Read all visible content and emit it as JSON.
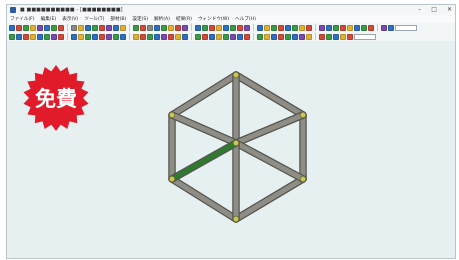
{
  "window": {
    "title": "■ ■■■■■■■■■■ - [■■■■■■■■]"
  },
  "menu": {
    "items": [
      "ファイル(F)",
      "編集(E)",
      "表示(V)",
      "ツール(T)",
      "部材(B)",
      "設定(S)",
      "解析(A)",
      "結果(R)",
      "ウィンドウ(W)",
      "ヘルプ(H)"
    ]
  },
  "toolbar": {
    "row1": [
      "#2f6fbf",
      "#d24a3a",
      "#3a9a4a",
      "#e0b030",
      "#7a4ab0",
      "#2f6fbf",
      "#3a9a4a",
      "#d24a3a",
      "#888",
      "#e0b030",
      "#2f6fbf",
      "#3a9a4a",
      "#d24a3a",
      "#7a4ab0",
      "#2f6fbf",
      "#e0b030",
      "#3a9a4a",
      "#d24a3a",
      "#888",
      "#2f6fbf",
      "#3a9a4a",
      "#e0b030",
      "#d24a3a",
      "#7a4ab0",
      "#2f6fbf",
      "#3a9a4a",
      "#d24a3a",
      "#e0b030",
      "#2f6fbf",
      "#3a9a4a",
      "#d24a3a",
      "#7a4ab0",
      "#2f6fbf",
      "#e0b030",
      "#3a9a4a",
      "#d24a3a",
      "#2f6fbf",
      "#3a9a4a",
      "#e0b030",
      "#d24a3a",
      "#7a4ab0",
      "#2f6fbf",
      "#3a9a4a",
      "#d24a3a",
      "#e0b030",
      "#2f6fbf",
      "#3a9a4a",
      "#d24a3a",
      "#7a4ab0",
      "#2f6fbf"
    ],
    "row2": [
      "#3a9a4a",
      "#2f6fbf",
      "#d24a3a",
      "#e0b030",
      "#2f6fbf",
      "#3a9a4a",
      "#7a4ab0",
      "#d24a3a",
      "#2f6fbf",
      "#e0b030",
      "#3a9a4a",
      "#2f6fbf",
      "#d24a3a",
      "#7a4ab0",
      "#3a9a4a",
      "#2f6fbf",
      "#e0b030",
      "#d24a3a",
      "#3a9a4a",
      "#2f6fbf",
      "#7a4ab0",
      "#d24a3a",
      "#e0b030",
      "#2f6fbf",
      "#3a9a4a",
      "#d24a3a",
      "#2f6fbf",
      "#e0b030",
      "#3a9a4a",
      "#7a4ab0",
      "#2f6fbf",
      "#d24a3a",
      "#3a9a4a",
      "#e0b030",
      "#2f6fbf",
      "#d24a3a",
      "#3a9a4a",
      "#2f6fbf",
      "#7a4ab0",
      "#e0b030",
      "#d24a3a",
      "#3a9a4a",
      "#2f6fbf",
      "#e0b030",
      "#d24a3a"
    ]
  },
  "badge": {
    "label": "免費",
    "color": "#e21b2b"
  },
  "model": {
    "member_color": "#8e8e86",
    "member_edge": "#55554f",
    "selected_color": "#2f7a2f",
    "node_color": "#c8c858"
  }
}
